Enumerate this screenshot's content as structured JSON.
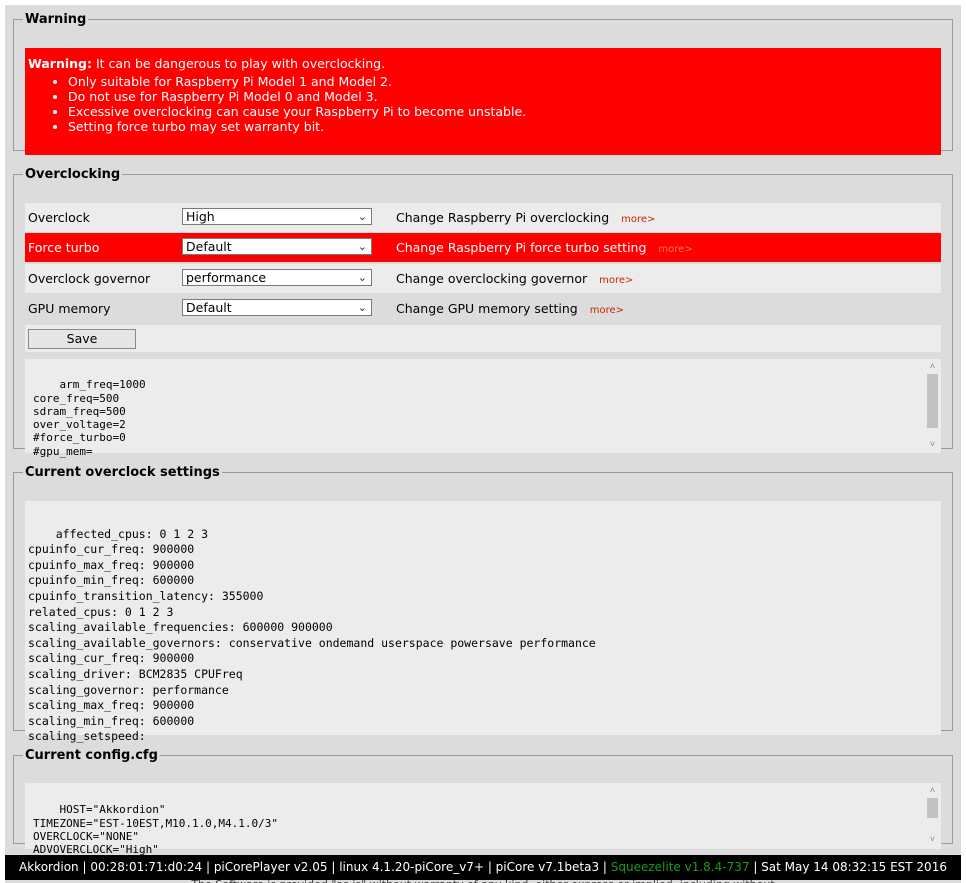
{
  "warning": {
    "legend": "Warning",
    "prefix": "Warning:",
    "message": " It can be dangerous to play with overclocking.",
    "items": [
      "Only suitable for Raspberry Pi Model 1 and Model 2.",
      "Do not use for Raspberry Pi Model 0 and Model 3.",
      "Excessive overclocking can cause your Raspberry Pi to become unstable.",
      "Setting force turbo may set warranty bit."
    ]
  },
  "overclocking": {
    "legend": "Overclocking",
    "rows": [
      {
        "label": "Overclock",
        "value": "High",
        "desc": "Change Raspberry Pi overclocking",
        "more": "more>"
      },
      {
        "label": "Force turbo",
        "value": "Default",
        "desc": "Change Raspberry Pi force turbo setting",
        "more": "more>"
      },
      {
        "label": "Overclock governor",
        "value": "performance",
        "desc": "Change overclocking governor",
        "more": "more>"
      },
      {
        "label": "GPU memory",
        "value": "Default",
        "desc": "Change GPU memory setting",
        "more": "more>"
      }
    ],
    "save_label": "Save",
    "config_text": "arm_freq=1000\ncore_freq=500\nsdram_freq=500\nover_voltage=2\n#force_turbo=0\n#gpu_mem="
  },
  "current_settings": {
    "legend": "Current overclock settings",
    "text": "affected_cpus: 0 1 2 3\ncpuinfo_cur_freq: 900000\ncpuinfo_max_freq: 900000\ncpuinfo_min_freq: 600000\ncpuinfo_transition_latency: 355000\nrelated_cpus: 0 1 2 3\nscaling_available_frequencies: 600000 900000\nscaling_available_governors: conservative ondemand userspace powersave performance\nscaling_cur_freq: 900000\nscaling_driver: BCM2835 CPUFreq\nscaling_governor: performance\nscaling_max_freq: 900000\nscaling_min_freq: 600000\nscaling_setspeed:"
  },
  "current_config": {
    "legend": "Current config.cfg",
    "text": "HOST=\"Akkordion\"\nTIMEZONE=\"EST-10EST,M10.1.0,M4.1.0/3\"\nOVERCLOCK=\"NONE\"\nADVOVERCLOCK=\"High\""
  },
  "status": {
    "left": "Akkordion | 00:28:01:71:d0:24 | piCorePlayer v2.05 | linux 4.1.20-piCore_v7+ | piCore v7.1beta3 | ",
    "squeezelite": "Squeezelite v1.8.4-737",
    "right": " | Sat May 14 08:32:15 EST 2016"
  },
  "footer_cut": "The Software is provided \"as is\" without warranty of any kind, either express or implied, including without",
  "colors": {
    "warning_bg": "#ff0000",
    "more_link": "#c62800",
    "squeezelite_green": "#1a9a1a",
    "status_bg": "#000000"
  }
}
